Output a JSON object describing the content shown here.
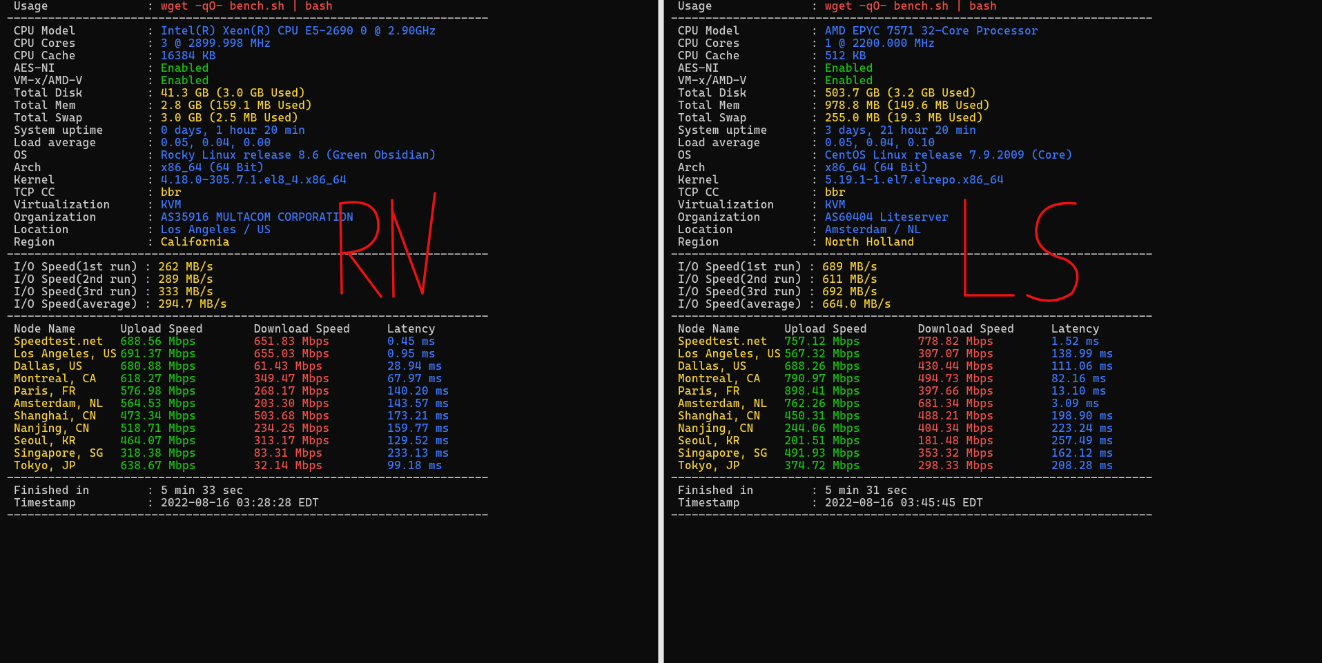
{
  "dash": "----------------------------------------------------------------------",
  "usage_label": " Usage",
  "usage_cmd": "wget -qO- bench.sh | bash",
  "io_labels": {
    "r1": " I/O Speed(1st run) : ",
    "r2": " I/O Speed(2nd run) : ",
    "r3": " I/O Speed(3rd run) : ",
    "avg": " I/O Speed(average) : "
  },
  "speed_header": {
    "node": " Node Name",
    "up": "Upload Speed",
    "down": "Download Speed",
    "lat": "Latency"
  },
  "footer_labels": {
    "finished": " Finished in",
    "timestamp": " Timestamp"
  },
  "left": {
    "annotation": "RN",
    "specs": [
      {
        "k": " CPU Model",
        "v": "Intel(R) Xeon(R) CPU E5-2690 0 @ 2.90GHz",
        "cls": "b"
      },
      {
        "k": " CPU Cores",
        "v": "3 @ 2899.998 MHz",
        "cls": "b"
      },
      {
        "k": " CPU Cache",
        "v": "16384 KB",
        "cls": "b"
      },
      {
        "k": " AES-NI",
        "v": "Enabled",
        "cls": "g"
      },
      {
        "k": " VM-x/AMD-V",
        "v": "Enabled",
        "cls": "g"
      },
      {
        "k": " Total Disk",
        "v": "41.3 GB (3.0 GB Used)",
        "cls": "y"
      },
      {
        "k": " Total Mem",
        "v": "2.8 GB (159.1 MB Used)",
        "cls": "y"
      },
      {
        "k": " Total Swap",
        "v": "3.0 GB (2.5 MB Used)",
        "cls": "y"
      },
      {
        "k": " System uptime",
        "v": "0 days, 1 hour 20 min",
        "cls": "b"
      },
      {
        "k": " Load average",
        "v": "0.05, 0.04, 0.00",
        "cls": "b"
      },
      {
        "k": " OS",
        "v": "Rocky Linux release 8.6 (Green Obsidian)",
        "cls": "b"
      },
      {
        "k": " Arch",
        "v": "x86_64 (64 Bit)",
        "cls": "b"
      },
      {
        "k": " Kernel",
        "v": "4.18.0-305.7.1.el8_4.x86_64",
        "cls": "b"
      },
      {
        "k": " TCP CC",
        "v": "bbr",
        "cls": "y"
      },
      {
        "k": " Virtualization",
        "v": "KVM",
        "cls": "b"
      },
      {
        "k": " Organization",
        "v": "AS35916 MULTACOM CORPORATION",
        "cls": "b"
      },
      {
        "k": " Location",
        "v": "Los Angeles / US",
        "cls": "b"
      },
      {
        "k": " Region",
        "v": "California",
        "cls": "y"
      }
    ],
    "io": {
      "r1": "262 MB/s",
      "r2": "289 MB/s",
      "r3": "333 MB/s",
      "avg": "294.7 MB/s"
    },
    "speed": [
      {
        "node": " Speedtest.net",
        "up": "688.56 Mbps",
        "down": "651.83 Mbps",
        "lat": "0.45 ms"
      },
      {
        "node": " Los Angeles, US",
        "up": "691.37 Mbps",
        "down": "655.03 Mbps",
        "lat": "0.95 ms"
      },
      {
        "node": " Dallas, US",
        "up": "680.88 Mbps",
        "down": "61.43 Mbps",
        "lat": "28.94 ms"
      },
      {
        "node": " Montreal, CA",
        "up": "618.27 Mbps",
        "down": "349.47 Mbps",
        "lat": "67.97 ms"
      },
      {
        "node": " Paris, FR",
        "up": "576.98 Mbps",
        "down": "268.17 Mbps",
        "lat": "140.20 ms"
      },
      {
        "node": " Amsterdam, NL",
        "up": "564.53 Mbps",
        "down": "203.30 Mbps",
        "lat": "143.57 ms"
      },
      {
        "node": " Shanghai, CN",
        "up": "473.34 Mbps",
        "down": "503.68 Mbps",
        "lat": "173.21 ms"
      },
      {
        "node": " Nanjing, CN",
        "up": "518.71 Mbps",
        "down": "234.25 Mbps",
        "lat": "159.77 ms"
      },
      {
        "node": " Seoul, KR",
        "up": "464.07 Mbps",
        "down": "313.17 Mbps",
        "lat": "129.52 ms"
      },
      {
        "node": " Singapore, SG",
        "up": "318.38 Mbps",
        "down": "83.31 Mbps",
        "lat": "233.13 ms"
      },
      {
        "node": " Tokyo, JP",
        "up": "638.67 Mbps",
        "down": "32.14 Mbps",
        "lat": "99.18 ms"
      }
    ],
    "finished": "5 min 33 sec",
    "timestamp": "2022-08-16 03:28:28 EDT"
  },
  "right": {
    "annotation": "LS",
    "specs": [
      {
        "k": " CPU Model",
        "v": "AMD EPYC 7571 32-Core Processor",
        "cls": "b"
      },
      {
        "k": " CPU Cores",
        "v": "1 @ 2200.000 MHz",
        "cls": "b"
      },
      {
        "k": " CPU Cache",
        "v": "512 KB",
        "cls": "b"
      },
      {
        "k": " AES-NI",
        "v": "Enabled",
        "cls": "g"
      },
      {
        "k": " VM-x/AMD-V",
        "v": "Enabled",
        "cls": "g"
      },
      {
        "k": " Total Disk",
        "v": "503.7 GB (3.2 GB Used)",
        "cls": "y"
      },
      {
        "k": " Total Mem",
        "v": "978.8 MB (149.6 MB Used)",
        "cls": "y"
      },
      {
        "k": " Total Swap",
        "v": "255.0 MB (19.3 MB Used)",
        "cls": "y"
      },
      {
        "k": " System uptime",
        "v": "3 days, 21 hour 20 min",
        "cls": "b"
      },
      {
        "k": " Load average",
        "v": "0.05, 0.04, 0.10",
        "cls": "b"
      },
      {
        "k": " OS",
        "v": "CentOS Linux release 7.9.2009 (Core)",
        "cls": "b"
      },
      {
        "k": " Arch",
        "v": "x86_64 (64 Bit)",
        "cls": "b"
      },
      {
        "k": " Kernel",
        "v": "5.19.1-1.el7.elrepo.x86_64",
        "cls": "b"
      },
      {
        "k": " TCP CC",
        "v": "bbr",
        "cls": "y"
      },
      {
        "k": " Virtualization",
        "v": "KVM",
        "cls": "b"
      },
      {
        "k": " Organization",
        "v": "AS60404 Liteserver",
        "cls": "b"
      },
      {
        "k": " Location",
        "v": "Amsterdam / NL",
        "cls": "b"
      },
      {
        "k": " Region",
        "v": "North Holland",
        "cls": "y"
      }
    ],
    "io": {
      "r1": "689 MB/s",
      "r2": "611 MB/s",
      "r3": "692 MB/s",
      "avg": "664.0 MB/s"
    },
    "speed": [
      {
        "node": " Speedtest.net",
        "up": "757.12 Mbps",
        "down": "778.82 Mbps",
        "lat": "1.52 ms"
      },
      {
        "node": " Los Angeles, US",
        "up": "567.32 Mbps",
        "down": "307.07 Mbps",
        "lat": "138.99 ms"
      },
      {
        "node": " Dallas, US",
        "up": "688.26 Mbps",
        "down": "430.44 Mbps",
        "lat": "111.06 ms"
      },
      {
        "node": " Montreal, CA",
        "up": "790.97 Mbps",
        "down": "494.73 Mbps",
        "lat": "82.16 ms"
      },
      {
        "node": " Paris, FR",
        "up": "898.41 Mbps",
        "down": "397.66 Mbps",
        "lat": "13.10 ms"
      },
      {
        "node": " Amsterdam, NL",
        "up": "762.26 Mbps",
        "down": "681.34 Mbps",
        "lat": "3.09 ms"
      },
      {
        "node": " Shanghai, CN",
        "up": "450.31 Mbps",
        "down": "488.21 Mbps",
        "lat": "198.90 ms"
      },
      {
        "node": " Nanjing, CN",
        "up": "244.06 Mbps",
        "down": "404.34 Mbps",
        "lat": "223.24 ms"
      },
      {
        "node": " Seoul, KR",
        "up": "201.51 Mbps",
        "down": "181.48 Mbps",
        "lat": "257.49 ms"
      },
      {
        "node": " Singapore, SG",
        "up": "491.93 Mbps",
        "down": "353.32 Mbps",
        "lat": "162.12 ms"
      },
      {
        "node": " Tokyo, JP",
        "up": "374.72 Mbps",
        "down": "298.33 Mbps",
        "lat": "208.28 ms"
      }
    ],
    "finished": "5 min 31 sec",
    "timestamp": "2022-08-16 03:45:45 EDT"
  }
}
